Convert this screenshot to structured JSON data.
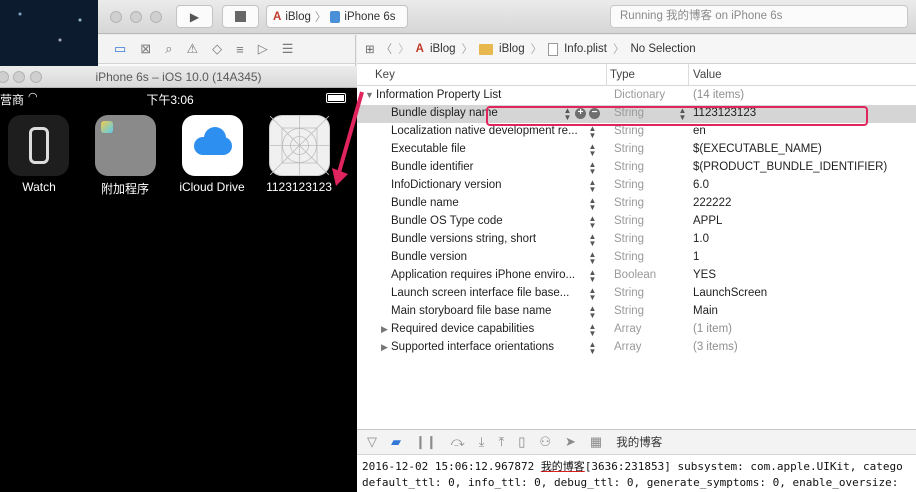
{
  "toolbar": {
    "scheme_target": "iBlog",
    "scheme_device": "iPhone 6s",
    "status": "Running 我的博客 on iPhone 6s"
  },
  "jumpbar": {
    "crumbs": [
      "iBlog",
      "iBlog",
      "Info.plist",
      "No Selection"
    ]
  },
  "plist": {
    "headers": {
      "key": "Key",
      "type": "Type",
      "value": "Value"
    },
    "root": {
      "key": "Information Property List",
      "type": "Dictionary",
      "value": "(14 items)"
    },
    "rows": [
      {
        "key": "Bundle display name",
        "type": "String",
        "value": "1123123123",
        "selected": true
      },
      {
        "key": "Localization native development re...",
        "type": "String",
        "value": "en"
      },
      {
        "key": "Executable file",
        "type": "String",
        "value": "$(EXECUTABLE_NAME)"
      },
      {
        "key": "Bundle identifier",
        "type": "String",
        "value": "$(PRODUCT_BUNDLE_IDENTIFIER)"
      },
      {
        "key": "InfoDictionary version",
        "type": "String",
        "value": "6.0"
      },
      {
        "key": "Bundle name",
        "type": "String",
        "value": "222222"
      },
      {
        "key": "Bundle OS Type code",
        "type": "String",
        "value": "APPL"
      },
      {
        "key": "Bundle versions string, short",
        "type": "String",
        "value": "1.0"
      },
      {
        "key": "Bundle version",
        "type": "String",
        "value": "1"
      },
      {
        "key": "Application requires iPhone enviro...",
        "type": "Boolean",
        "value": "YES"
      },
      {
        "key": "Launch screen interface file base...",
        "type": "String",
        "value": "LaunchScreen"
      },
      {
        "key": "Main storyboard file base name",
        "type": "String",
        "value": "Main"
      },
      {
        "key": "Required device capabilities",
        "type": "Array",
        "value": "(1 item)",
        "collapsed": true
      },
      {
        "key": "Supported interface orientations",
        "type": "Array",
        "value": "(3 items)",
        "collapsed": true
      }
    ]
  },
  "debugbar": {
    "app": "我的博客"
  },
  "console": {
    "line1_prefix": "2016-12-02 15:06:12.967872 ",
    "line1_app": "我的博客",
    "line1_rest": "[3636:231853] subsystem: com.apple.UIKit, catego",
    "line2": "default_ttl: 0, info_ttl: 0, debug_ttl: 0, generate_symptoms: 0, enable_oversize:"
  },
  "simulator": {
    "title": "iPhone 6s – iOS 10.0 (14A345)",
    "carrier": "营商",
    "time": "下午3:06",
    "apps": [
      {
        "label": "Watch",
        "icon": "watch-icon"
      },
      {
        "label": "附加程序",
        "icon": "folder-icon"
      },
      {
        "label": "iCloud Drive",
        "icon": "icloud-icon"
      },
      {
        "label": "1123123123",
        "icon": "blank-app-icon"
      }
    ]
  },
  "colors": {
    "highlight": "#e0245e",
    "selection": "#d5d5d5"
  }
}
